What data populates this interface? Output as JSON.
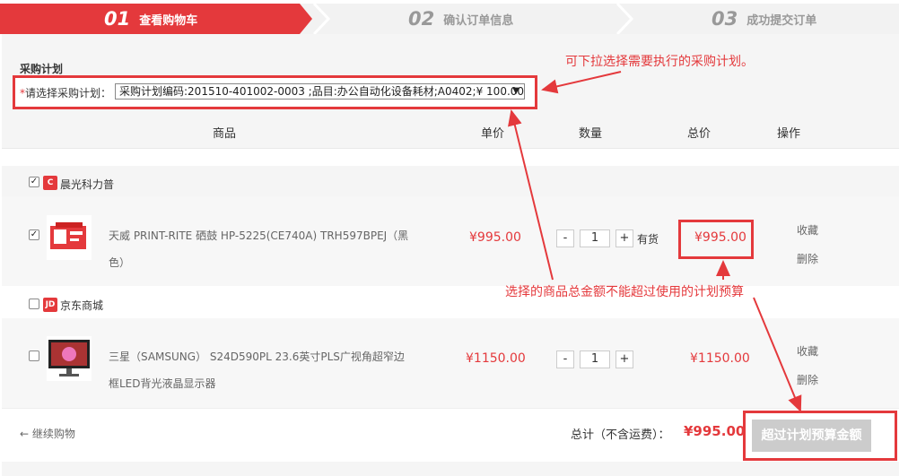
{
  "steps": [
    {
      "num": "01",
      "label": "查看购物车"
    },
    {
      "num": "02",
      "label": "确认订单信息"
    },
    {
      "num": "03",
      "label": "成功提交订单"
    }
  ],
  "plan": {
    "title": "采购计划",
    "required_mark": "*",
    "label": "请选择采购计划：",
    "selected": "采购计划编码:201510-401002-0003 ;品目:办公自动化设备耗材;A0402;¥ 100.00",
    "arrow": "▼"
  },
  "annotations": {
    "note1": "可下拉选择需要执行的采购计划。",
    "note2": "选择的商品总金额不能超过使用的计划预算"
  },
  "table": {
    "headers": {
      "product": "商品",
      "unit_price": "单价",
      "quantity": "数量",
      "total": "总价",
      "action": "操作"
    }
  },
  "shops": [
    {
      "name": "晨光科力普",
      "logo": "C",
      "checked": true,
      "items": [
        {
          "checked": true,
          "name": "天威 PRINT-RITE 硒鼓 HP-5225(CE740A) TRH597BPEJ（黑色）",
          "unit_price": "¥995.00",
          "qty": "1",
          "minus": "-",
          "plus": "+",
          "stock": "有货",
          "total": "¥995.00",
          "fav": "收藏",
          "del": "删除"
        }
      ]
    },
    {
      "name": "京东商城",
      "logo": "JD",
      "checked": false,
      "items": [
        {
          "checked": false,
          "name": "三星（SAMSUNG） S24D590PL 23.6英寸PLS广视角超窄边框LED背光液晶显示器",
          "unit_price": "¥1150.00",
          "qty": "1",
          "minus": "-",
          "plus": "+",
          "total": "¥1150.00",
          "fav": "收藏",
          "del": "删除"
        }
      ]
    }
  ],
  "footer": {
    "continue": "← 继续购物",
    "total_label": "总计（不含运费）：",
    "total_value": "¥995.00",
    "over_budget_button": "超过计划预算金额"
  },
  "colors": {
    "accent": "#e4393c"
  }
}
